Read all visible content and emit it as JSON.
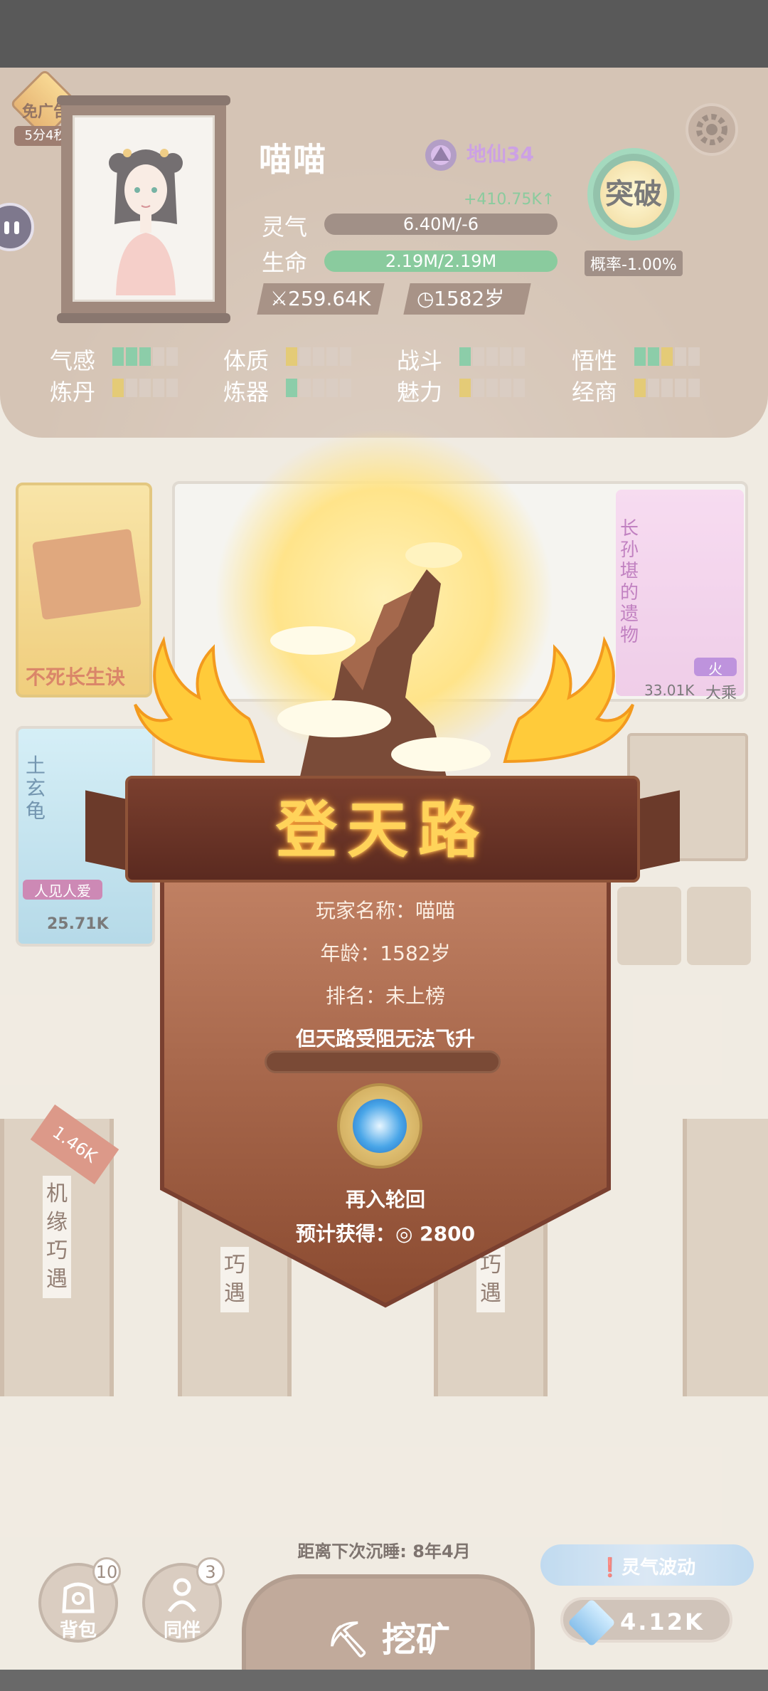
{
  "no_ad": {
    "label": "免广告",
    "timer": "5分4秒"
  },
  "player": {
    "name": "喵喵",
    "realm": "地仙34",
    "gain": "+410.75K↑",
    "qi_label": "灵气",
    "qi_value": "6.40M/-6",
    "life_label": "生命",
    "life_value": "2.19M/2.19M",
    "life_fill": 1.0,
    "power": "259.64K",
    "age": "1582岁"
  },
  "breakthrough": {
    "label": "突破",
    "probability": "概率-1.00%"
  },
  "attributes": [
    {
      "label": "气感",
      "levels": [
        "g",
        "g",
        "g",
        "n",
        "n"
      ]
    },
    {
      "label": "体质",
      "levels": [
        "y",
        "n",
        "n",
        "n",
        "n"
      ]
    },
    {
      "label": "战斗",
      "levels": [
        "g",
        "n",
        "n",
        "n",
        "n"
      ]
    },
    {
      "label": "悟性",
      "levels": [
        "g",
        "g",
        "y",
        "n",
        "n"
      ]
    },
    {
      "label": "炼丹",
      "levels": [
        "y",
        "n",
        "n",
        "n",
        "n"
      ]
    },
    {
      "label": "炼器",
      "levels": [
        "g",
        "n",
        "n",
        "n",
        "n"
      ]
    },
    {
      "label": "魅力",
      "levels": [
        "y",
        "n",
        "n",
        "n",
        "n"
      ]
    },
    {
      "label": "经商",
      "levels": [
        "y",
        "n",
        "n",
        "n",
        "n"
      ]
    }
  ],
  "cards": {
    "yellow_title": "不死长生诀",
    "right_card_title": "长孙堪的遗物",
    "right_card_tag": "火",
    "right_card_value": "33.01K",
    "right_card_rank": "大乘",
    "blue_card_title": "土玄龟",
    "blue_card_tag": "人见人爱",
    "blue_card_value": "25.71K"
  },
  "scrolls": {
    "left_text": "机缘巧遇",
    "left_badge": "1.46K",
    "mid_text": "巧遇"
  },
  "popup": {
    "title": "登天路",
    "player_name_line": "玩家名称：喵喵",
    "age_line": "年龄：1582岁",
    "rank_line": "排名：未上榜",
    "hint": "但天路受阻无法飞升",
    "reincarnate_label": "再入轮回",
    "expected_label": "预计获得：",
    "expected_value": "2800"
  },
  "bottom": {
    "sleep_text": "距离下次沉睡: 8年4月",
    "bag_label": "背包",
    "bag_count": "10",
    "companion_label": "同伴",
    "companion_count": "3",
    "mine_label": "挖矿",
    "wave_label": "灵气波动",
    "gem_value": "4.12K"
  },
  "colors": {
    "accent": "#ffd35a",
    "panel": "#a0603e",
    "life": "#4caf6a",
    "realm": "#b16fd6"
  }
}
